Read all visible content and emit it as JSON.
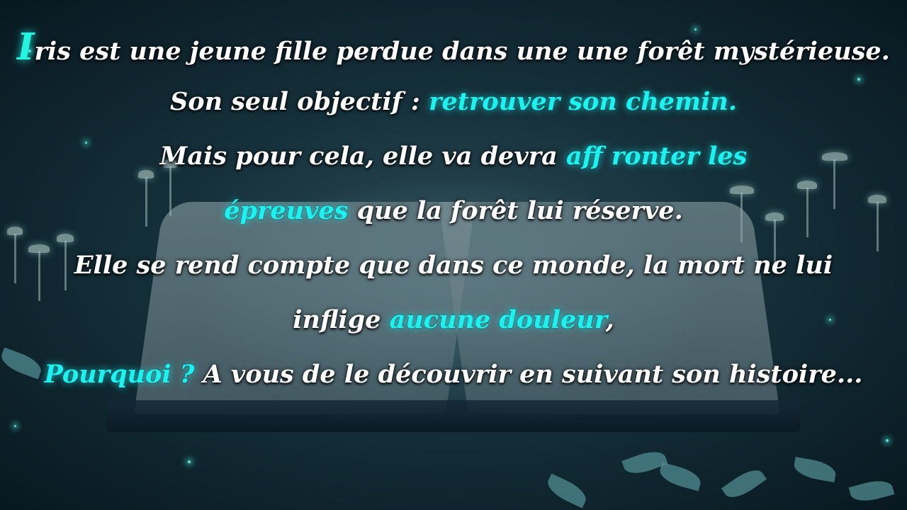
{
  "story": {
    "line1": {
      "dropcap": "I",
      "text": "ris est une jeune fille perdue dans une une forêt mystérieuse."
    },
    "line2": {
      "text": "Son seul objectif : ",
      "highlight": "retrouver son chemin."
    },
    "line3": {
      "text": "Mais pour cela, elle va devra ",
      "highlight": "aff ronter les"
    },
    "line4": {
      "highlight": "épreuves",
      "text": " que la forêt lui réserve."
    },
    "line5": {
      "text": "Elle se rend compte que dans ce monde, la mort ne lui"
    },
    "line6": {
      "text": "inflige ",
      "highlight": "aucune douleur",
      "suffix": ","
    },
    "line7": {
      "highlight": "Pourquoi ?",
      "text": " A  vous de le découvrir en suivant son histoire..."
    }
  },
  "colors": {
    "text": "#ffffff",
    "highlight": "#1ef2f0",
    "background": "#15303a"
  }
}
